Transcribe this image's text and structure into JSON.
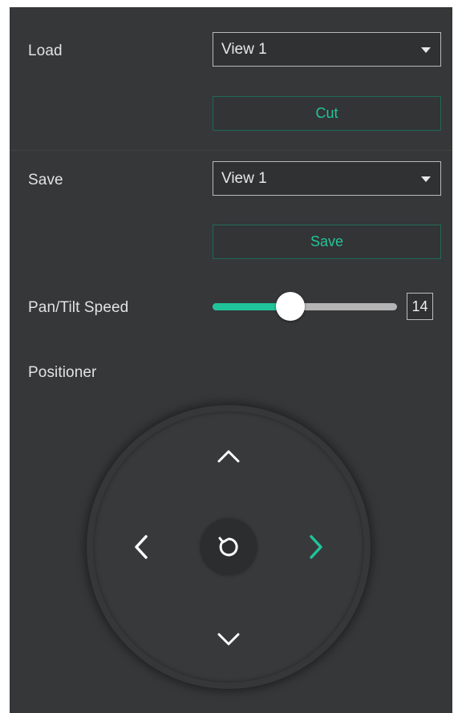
{
  "load": {
    "label": "Load",
    "selected": "View 1",
    "action_label": "Cut"
  },
  "save": {
    "label": "Save",
    "selected": "View 1",
    "action_label": "Save"
  },
  "pan_tilt_speed": {
    "label": "Pan/Tilt Speed",
    "value": "14",
    "slider_fraction": 0.42
  },
  "positioner": {
    "label": "Positioner",
    "up_icon": "chevron-up-icon",
    "down_icon": "chevron-down-icon",
    "left_icon": "chevron-left-icon",
    "right_icon": "chevron-right-icon",
    "center_icon": "reset-icon",
    "active_direction": "right"
  },
  "colors": {
    "background": "#353739",
    "accent": "#20c39a",
    "text": "#e2e2e2"
  }
}
